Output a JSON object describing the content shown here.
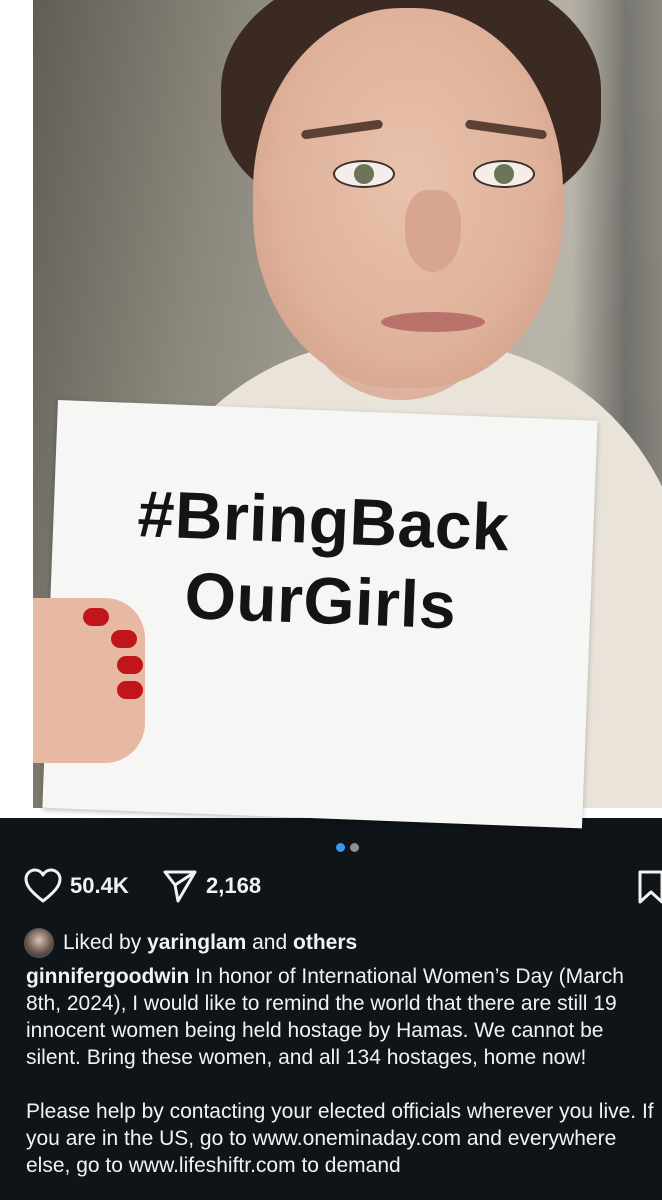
{
  "post": {
    "sign_line_1": "#BringBack",
    "sign_line_2": "OurGirls",
    "carousel": {
      "count": 2,
      "active_index": 0
    },
    "likes_count": "50.4K",
    "shares_count": "2,168",
    "liked_by": {
      "prefix": "Liked by",
      "user": "yaringlam",
      "joiner": "and",
      "others": "others"
    },
    "caption": {
      "username": "ginnifergoodwin",
      "text": "In honor of International Women’s Day (March 8th, 2024), I would like to remind the world that there are still 19 innocent women being held hostage by Hamas. We cannot be silent. Bring these women, and all 134 hostages, home now!",
      "paragraph_2": "Please help by contacting your elected officials wherever you live. If you are in the US, go to www.oneminaday.com and everywhere else, go to www.lifeshiftr.com to demand"
    },
    "icons": [
      "heart-icon",
      "send-icon",
      "bookmark-icon"
    ],
    "colors": {
      "background": "#0f1419",
      "active_dot": "#3897f0",
      "inactive_dot": "#8e8e8e",
      "nail_polish": "#c0161b"
    }
  }
}
